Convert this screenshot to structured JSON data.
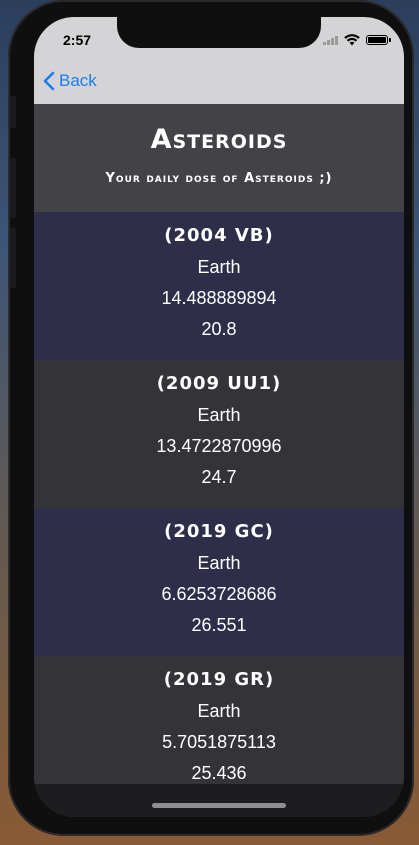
{
  "status_bar": {
    "time": "2:57"
  },
  "nav": {
    "back_label": "Back"
  },
  "header": {
    "title": "Asteroids",
    "subtitle": "Your daily dose of Asteroids ;)"
  },
  "asteroids": [
    {
      "name": "(2004 VB)",
      "orbiting_body": "Earth",
      "distance": "14.488889894",
      "magnitude": "20.8"
    },
    {
      "name": "(2009 UU1)",
      "orbiting_body": "Earth",
      "distance": "13.4722870996",
      "magnitude": "24.7"
    },
    {
      "name": "(2019 GC)",
      "orbiting_body": "Earth",
      "distance": "6.6253728686",
      "magnitude": "26.551"
    },
    {
      "name": "(2019 GR)",
      "orbiting_body": "Earth",
      "distance": "5.7051875113",
      "magnitude": "25.436"
    }
  ],
  "icons": {
    "back": "chevron-left-icon",
    "signal": "cellular-signal-icon",
    "wifi": "wifi-icon",
    "battery": "battery-icon"
  },
  "colors": {
    "accent": "#1a7cf5",
    "header_bg": "#434347",
    "row_bg_a": "#2e2e4b",
    "row_bg_b": "#333338"
  }
}
